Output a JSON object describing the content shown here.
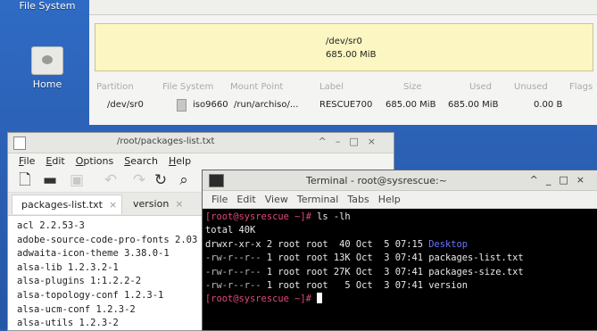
{
  "desktop": {
    "icons": [
      {
        "label": "File System"
      },
      {
        "label": "Home"
      }
    ]
  },
  "gparted": {
    "device_path": "/dev/sr0",
    "device_size": "685.00 MiB",
    "columns": [
      "Partition",
      "File System",
      "Mount Point",
      "Label",
      "Size",
      "Used",
      "Unused",
      "Flags"
    ],
    "row": {
      "partition": "/dev/sr0",
      "filesystem": "iso9660",
      "mount_point": "/run/archiso/...",
      "label": "RESCUE700",
      "size": "685.00 MiB",
      "used": "685.00 MiB",
      "unused": "0.00 B"
    }
  },
  "gedit": {
    "title": "/root/packages-list.txt",
    "menu": [
      "File",
      "Edit",
      "Options",
      "Search",
      "Help"
    ],
    "tabs": [
      {
        "label": "packages-list.txt",
        "close": "×"
      },
      {
        "label": "version",
        "close": "×"
      }
    ],
    "lines": [
      "acl 2.2.53-3",
      "adobe-source-code-pro-fonts 2.03",
      "adwaita-icon-theme 3.38.0-1",
      "alsa-lib 1.2.3.2-1",
      "alsa-plugins 1:1.2.2-2",
      "alsa-topology-conf 1.2.3-1",
      "alsa-ucm-conf 1.2.3-2",
      "alsa-utils 1.2.3-2"
    ]
  },
  "terminal": {
    "title": "Terminal - root@sysrescue:~",
    "menu": [
      "File",
      "Edit",
      "View",
      "Terminal",
      "Tabs",
      "Help"
    ],
    "prompt": "[root@sysrescue ~]# ",
    "command": "ls -lh",
    "total": "total 40K",
    "entries": [
      {
        "perms": "drwxr-xr-x",
        "rest": " 2 root root  40 Oct  5 07:15 ",
        "name": "Desktop"
      },
      {
        "perms": "-rw-r--r--",
        "rest": " 1 root root 13K Oct  3 07:41 ",
        "name": "packages-list.txt"
      },
      {
        "perms": "-rw-r--r--",
        "rest": " 1 root root 27K Oct  3 07:41 ",
        "name": "packages-size.txt"
      },
      {
        "perms": "-rw-r--r--",
        "rest": " 1 root root   5 Oct  3 07:41 ",
        "name": "version"
      }
    ]
  }
}
